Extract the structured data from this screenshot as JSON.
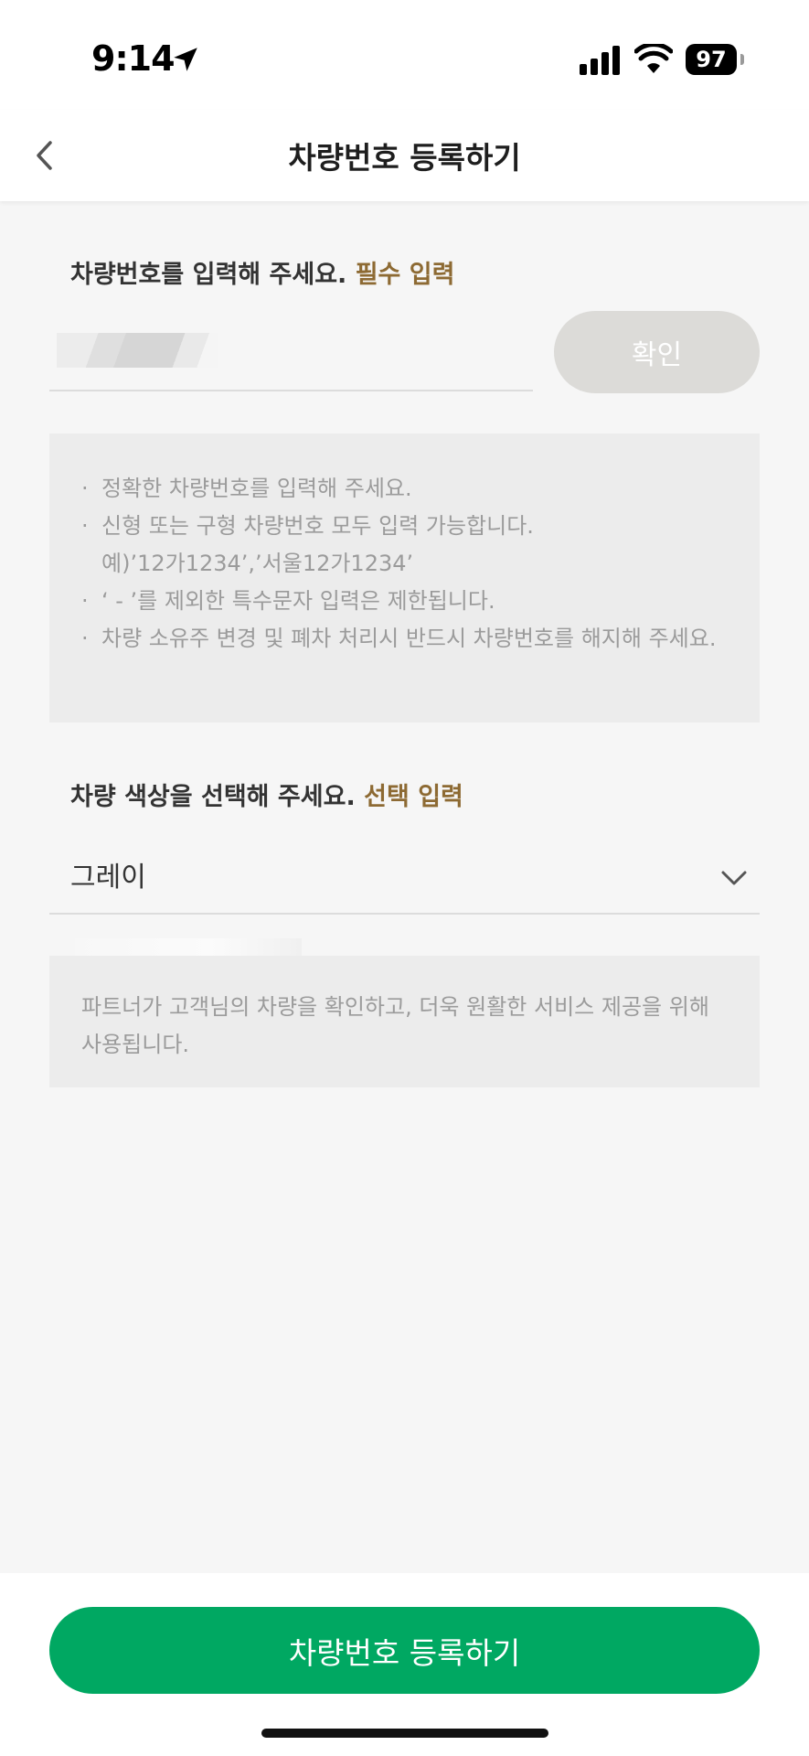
{
  "status_bar": {
    "time": "9:14",
    "battery": "97",
    "icons": [
      "location-arrow-icon",
      "cellular-signal-icon",
      "wifi-icon",
      "battery-icon"
    ]
  },
  "nav": {
    "title": "차량번호 등록하기",
    "back_icon": "chevron-left-icon"
  },
  "plate_section": {
    "label": "차량번호를 입력해 주세요.",
    "label_badge": "필수 입력",
    "input_value": "",
    "confirm_label": "확인",
    "notes": [
      "정확한 차량번호를 입력해 주세요.",
      "신형 또는 구형 차량번호 모두 입력 가능합니다.",
      "예)’12가1234’,’서울12가1234’",
      "‘ - ’를 제외한 특수문자 입력은 제한됩니다.",
      "차량 소유주 변경 및 폐차 처리시 반드시 차량번호를 해지해 주세요."
    ]
  },
  "color_section": {
    "label": "차량 색상을 선택해 주세요.",
    "label_badge": "선택 입력",
    "selected": "그레이",
    "note": "파트너가 고객님의 차량을 확인하고, 더욱 원활한 서비스 제공을 위해 사용됩니다."
  },
  "footer": {
    "register_label": "차량번호 등록하기"
  },
  "colors": {
    "accent_text": "#8d6a33",
    "primary_button": "#00a862",
    "disabled_button": "#dcdbd8",
    "background": "#f6f6f6",
    "info_box": "#ececec"
  }
}
